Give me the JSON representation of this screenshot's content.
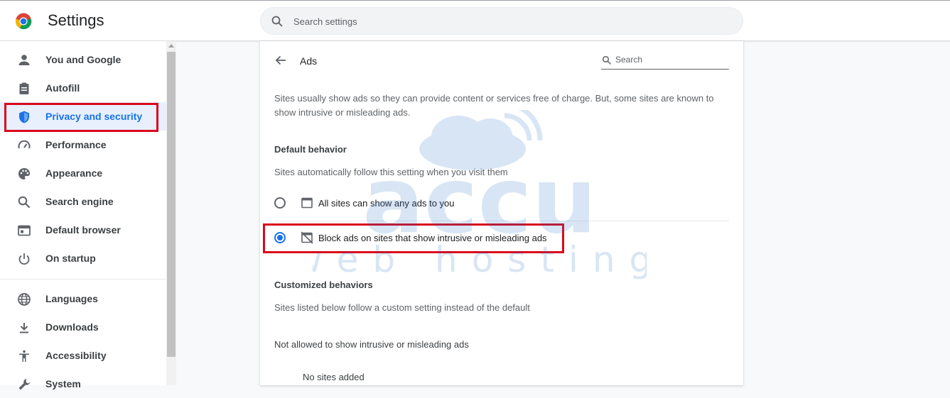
{
  "app": {
    "title": "Settings"
  },
  "search": {
    "placeholder": "Search settings"
  },
  "sidebar": {
    "items": [
      {
        "label": "You and Google",
        "icon": "person-icon"
      },
      {
        "label": "Autofill",
        "icon": "clipboard-icon"
      },
      {
        "label": "Privacy and security",
        "icon": "shield-icon",
        "active": true
      },
      {
        "label": "Performance",
        "icon": "speedometer-icon"
      },
      {
        "label": "Appearance",
        "icon": "palette-icon"
      },
      {
        "label": "Search engine",
        "icon": "search-icon"
      },
      {
        "label": "Default browser",
        "icon": "browser-window-icon"
      },
      {
        "label": "On startup",
        "icon": "power-icon"
      },
      {
        "label": "Languages",
        "icon": "globe-icon"
      },
      {
        "label": "Downloads",
        "icon": "download-icon"
      },
      {
        "label": "Accessibility",
        "icon": "accessibility-icon"
      },
      {
        "label": "System",
        "icon": "wrench-icon"
      }
    ]
  },
  "page": {
    "title": "Ads",
    "search_label": "Search",
    "description": "Sites usually show ads so they can provide content or services free of charge. But, some sites are known to show intrusive or misleading ads.",
    "default_behavior": {
      "heading": "Default behavior",
      "subtext": "Sites automatically follow this setting when you visit them",
      "options": [
        {
          "label": "All sites can show any ads to you",
          "checked": false,
          "icon": "ad-window-icon"
        },
        {
          "label": "Block ads on sites that show intrusive or misleading ads",
          "checked": true,
          "icon": "ads-blocked-icon"
        }
      ]
    },
    "customized": {
      "heading": "Customized behaviors",
      "subtext": "Sites listed below follow a custom setting instead of the default",
      "not_allowed_heading": "Not allowed to show intrusive or misleading ads",
      "empty_text": "No sites added"
    }
  },
  "watermark": {
    "line1": "accu",
    "line2": "web hosting"
  },
  "colors": {
    "accent": "#1a73e8",
    "highlight": "#d9091b",
    "active_bg": "#e8f0fe"
  }
}
